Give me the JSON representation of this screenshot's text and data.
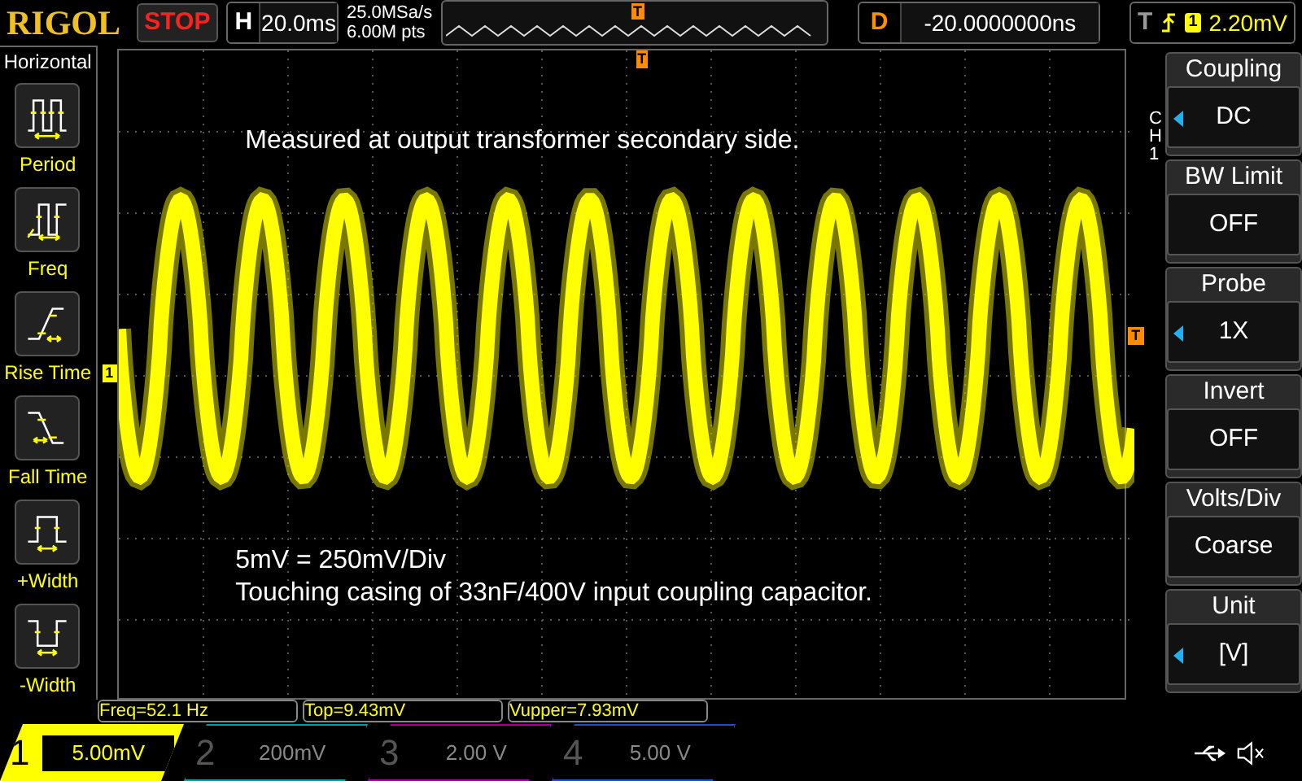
{
  "header": {
    "logo": "RIGOL",
    "run_state": "STOP",
    "timebase": {
      "label": "H",
      "value": "20.0ms"
    },
    "sample_rate": "25.0MSa/s",
    "memory_depth": "6.00M pts",
    "overview_marker": "T",
    "delay": {
      "label": "D",
      "value": "-20.0000000ns"
    },
    "trigger": {
      "label": "T",
      "source": "1",
      "level": "2.20mV"
    }
  },
  "measure_menu": {
    "title": "Horizontal",
    "items": [
      {
        "kind": "period",
        "label": "Period"
      },
      {
        "kind": "freq",
        "label": "Freq"
      },
      {
        "kind": "rise",
        "label": "Rise Time"
      },
      {
        "kind": "fall",
        "label": "Fall Time"
      },
      {
        "kind": "pwidth",
        "label": "+Width"
      },
      {
        "kind": "nwidth",
        "label": "-Width"
      }
    ]
  },
  "display": {
    "notes": [
      "Measured at output transformer secondary side.",
      "5mV = 250mV/Div",
      "Touching casing of 33nF/400V input coupling capacitor."
    ],
    "channel_marker": "1",
    "trigger_position_marker": "T",
    "trigger_level_marker": "T"
  },
  "measurements": [
    "Freq=52.1 Hz",
    "Top=9.43mV",
    "Vupper=7.93mV"
  ],
  "channel_menu": {
    "channel": "CH1",
    "items": [
      {
        "title": "Coupling",
        "value": "DC",
        "adjustable": true
      },
      {
        "title": "BW Limit",
        "value": "OFF",
        "adjustable": false
      },
      {
        "title": "Probe",
        "value": "1X",
        "adjustable": true
      },
      {
        "title": "Invert",
        "value": "OFF",
        "adjustable": false
      },
      {
        "title": "Volts/Div",
        "value": "Coarse",
        "adjustable": false
      },
      {
        "title": "Unit",
        "value": "[V]",
        "adjustable": true
      }
    ]
  },
  "channels": [
    {
      "number": "1",
      "scale": "5.00mV",
      "selected": true,
      "color": "#ffff00"
    },
    {
      "number": "2",
      "scale": "200mV",
      "selected": false,
      "color": "#00a0a0"
    },
    {
      "number": "3",
      "scale": "2.00 V",
      "selected": false,
      "color": "#a000a0"
    },
    {
      "number": "4",
      "scale": "5.00 V",
      "selected": false,
      "color": "#2050c0"
    }
  ]
}
